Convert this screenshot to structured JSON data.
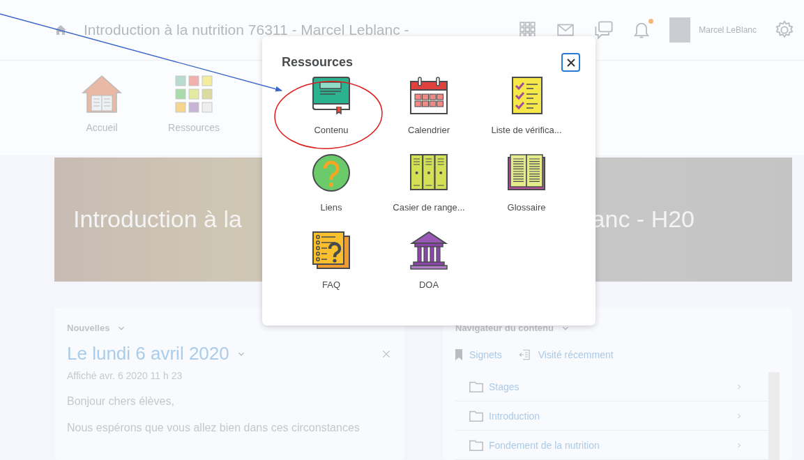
{
  "header": {
    "course_title": "Introduction à la nutrition 76311 - Marcel Leblanc -",
    "user_name": "Marcel LeBlanc",
    "notification_unread": true
  },
  "nav": [
    {
      "label": "Accueil",
      "kind": "home"
    },
    {
      "label": "Ressources",
      "kind": "resources"
    }
  ],
  "banner": {
    "title_left": "Introduction à la",
    "title_right": "anc - H20"
  },
  "news": {
    "heading": "Nouvelles",
    "headline": "Le lundi 6 avril 2020",
    "posted": "Affiché avr. 6 2020 11 h 23",
    "paragraphs": [
      "Bonjour chers élèves,",
      "Nous espérons que vous allez bien dans ces circonstances"
    ]
  },
  "navigator": {
    "heading": "Navigateur du contenu",
    "links": [
      {
        "label": "Signets",
        "kind": "bookmark"
      },
      {
        "label": "Visité récemment",
        "kind": "recent"
      }
    ],
    "items": [
      {
        "label": "Stages"
      },
      {
        "label": "Introduction"
      },
      {
        "label": "Fondement de la nutrition"
      }
    ]
  },
  "dialog": {
    "title": "Ressources",
    "items": [
      {
        "label": "Contenu",
        "kind": "book"
      },
      {
        "label": "Calendrier",
        "kind": "calendar"
      },
      {
        "label": "Liste de vérifica...",
        "kind": "checklist"
      },
      {
        "label": "Liens",
        "kind": "help"
      },
      {
        "label": "Casier de range...",
        "kind": "lockers"
      },
      {
        "label": "Glossaire",
        "kind": "glossary"
      },
      {
        "label": "FAQ",
        "kind": "faq"
      },
      {
        "label": "DOA",
        "kind": "institution"
      }
    ]
  }
}
